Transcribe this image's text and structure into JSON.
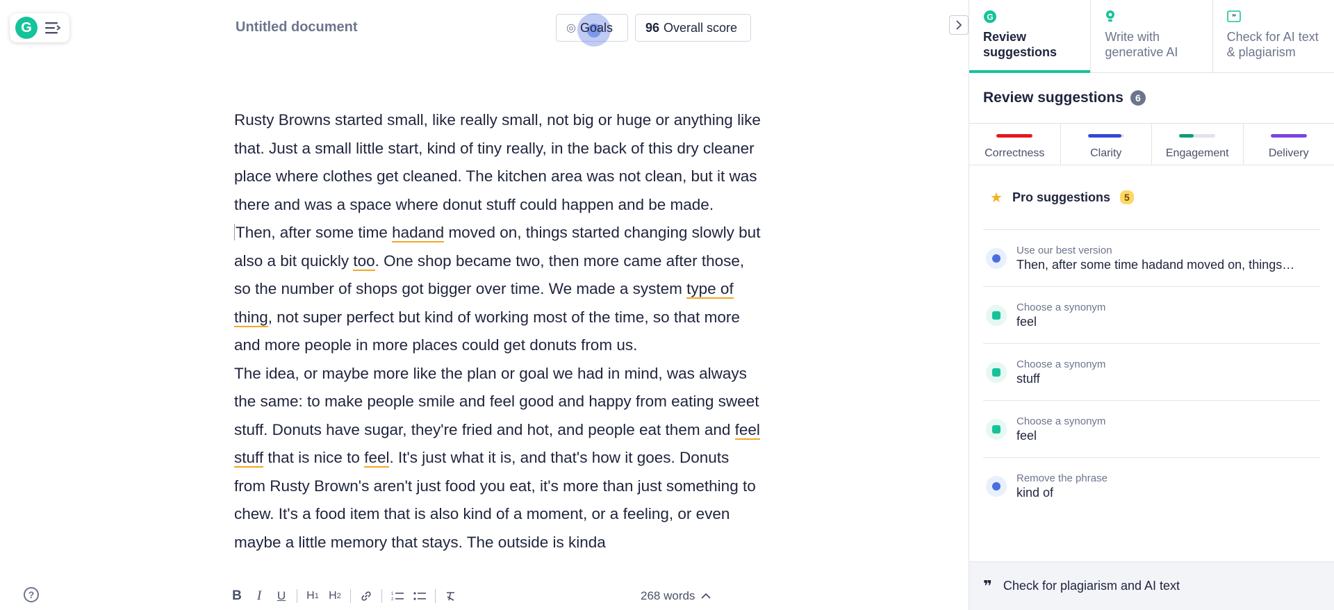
{
  "document": {
    "title": "Untitled document",
    "goals_label": "Goals",
    "score_value": "96",
    "score_label": "Overall score",
    "word_count": "268 words"
  },
  "editor": {
    "p1": "Rusty Browns started small, like really small, not big or huge or anything like that. Just a small little start, kind of tiny really, in the back of this dry cleaner place where clothes get cleaned. The kitchen area was not clean, but it was there and was a space where donut stuff could happen and be made.",
    "p2": {
      "a": "Then, after some time ",
      "u1": "hadand",
      "b": " moved on, things started changing slowly but also a bit quickly ",
      "u2": "too",
      "c": ". One shop became two, then more came after those, so the number of shops got bigger over time. We made a system ",
      "u3": "type of thing",
      "d": ", not super perfect but kind of working most of the time, so that more and more people in more places could get donuts from us."
    },
    "p3": {
      "a": "The idea, or maybe more like the plan or goal we had in mind, was always the same: to make people smile and feel good and happy from eating sweet stuff. Donuts have sugar, they're fried and hot, and people eat them and ",
      "u1": "feel",
      "s1": " ",
      "u2": "stuff",
      "b": " that is nice to ",
      "u3": "feel",
      "c": ". It's just what it is, and that's how it goes. Donuts from Rusty Brown's aren't just food you eat, it's more than just something to chew. It's a food item that is also kind of a moment, or a feeling, or even maybe a little memory that stays. The outside is kinda"
    }
  },
  "panel": {
    "tabs": [
      {
        "label": "Review suggestions",
        "icon": "grammarly-logo-icon"
      },
      {
        "label": "Write with generative AI",
        "icon": "bulb-icon"
      },
      {
        "label": "Check for AI text & plagiarism",
        "icon": "quote-icon"
      }
    ],
    "review_title": "Review suggestions",
    "review_count": "6",
    "categories": [
      {
        "label": "Correctness",
        "color": "#e5171f",
        "fill": 1.0
      },
      {
        "label": "Clarity",
        "color": "#3549d6",
        "fill": 0.92
      },
      {
        "label": "Engagement",
        "color": "#0f9d74",
        "fill": 0.4
      },
      {
        "label": "Delivery",
        "color": "#7e43e0",
        "fill": 1.0
      }
    ],
    "pro_label": "Pro suggestions",
    "pro_count": "5",
    "suggestions": [
      {
        "kind": "Use our best version",
        "value": "Then, after some time hadand moved on, things…",
        "color": "blue"
      },
      {
        "kind": "Choose a synonym",
        "value": "feel",
        "color": "green"
      },
      {
        "kind": "Choose a synonym",
        "value": "stuff",
        "color": "green"
      },
      {
        "kind": "Choose a synonym",
        "value": "feel",
        "color": "green"
      },
      {
        "kind": "Remove the phrase",
        "value": "kind of",
        "color": "blue"
      }
    ],
    "plagiarism_label": "Check for plagiarism and AI text"
  },
  "toolbar": {
    "buttons": [
      "bold",
      "italic",
      "underline",
      "heading-1",
      "heading-2",
      "link",
      "ordered-list",
      "bullet-list",
      "clear-formatting"
    ]
  }
}
